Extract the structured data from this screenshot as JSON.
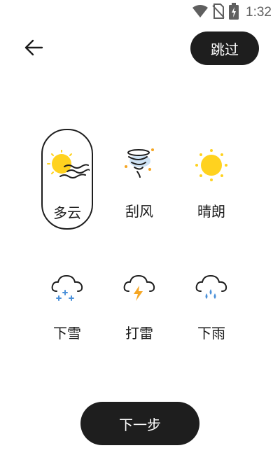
{
  "status_bar": {
    "time": "1:32",
    "icons": [
      "wifi-icon",
      "no-sim-icon",
      "battery-charging-icon"
    ]
  },
  "header": {
    "back_icon": "arrow-left-icon",
    "skip_label": "跳过"
  },
  "weather_options": [
    {
      "label": "多云",
      "icon": "sun-with-wind-icon",
      "selected": true
    },
    {
      "label": "刮风",
      "icon": "tornado-icon",
      "selected": false
    },
    {
      "label": "晴朗",
      "icon": "sun-icon",
      "selected": false
    },
    {
      "label": "下雪",
      "icon": "cloud-snow-icon",
      "selected": false
    },
    {
      "label": "打雷",
      "icon": "cloud-lightning-icon",
      "selected": false
    },
    {
      "label": "下雨",
      "icon": "cloud-rain-icon",
      "selected": false
    }
  ],
  "footer": {
    "next_label": "下一步"
  },
  "colors": {
    "sun": "#FFD21F",
    "dark": "#1E1E1E",
    "blue": "#4A90D9",
    "orange": "#F5A623"
  }
}
